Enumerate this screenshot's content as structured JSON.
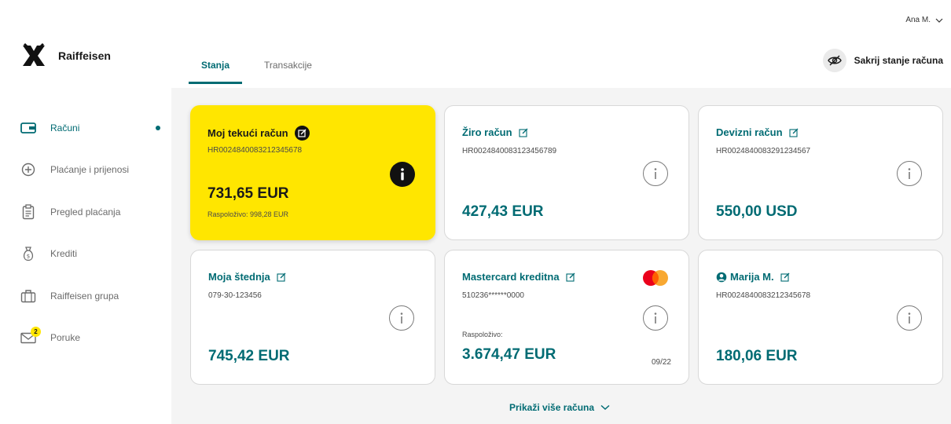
{
  "brand": {
    "name": "Raiffeisen",
    "accent": "#006b73",
    "highlight": "#ffe600"
  },
  "user": {
    "name": "Ana M."
  },
  "nav": [
    {
      "label": "Računi",
      "icon": "wallet-icon",
      "active": true
    },
    {
      "label": "Plaćanje i prijenosi",
      "icon": "plus-circle-icon"
    },
    {
      "label": "Pregled plaćanja",
      "icon": "clipboard-icon"
    },
    {
      "label": "Krediti",
      "icon": "money-bag-icon"
    },
    {
      "label": "Raiffeisen grupa",
      "icon": "briefcase-icon"
    },
    {
      "label": "Poruke",
      "icon": "envelope-icon",
      "badge": "2"
    }
  ],
  "tabs": [
    {
      "label": "Stanja",
      "active": true
    },
    {
      "label": "Transakcije"
    }
  ],
  "hide_balance": {
    "label": "Sakrij stanje računa",
    "icon": "eye-off-icon"
  },
  "accounts": [
    {
      "title": "Moj tekući račun",
      "iban": "HR0024840083212345678",
      "amount": "731,65 EUR",
      "available": "Raspoloživo: 998,28 EUR"
    },
    {
      "title": "Žiro račun",
      "iban": "HR0024840083123456789",
      "amount": "427,43 EUR"
    },
    {
      "title": "Devizni račun",
      "iban": "HR0024840083291234567",
      "amount": "550,00 USD"
    },
    {
      "title": "Moja štednja",
      "iban": "079-30-123456",
      "amount": "745,42 EUR"
    },
    {
      "title": "Mastercard kreditna",
      "iban": "510236******0000",
      "amount": "3.674,47 EUR",
      "available": "Raspoloživo:",
      "expiry": "09/22",
      "icon": "mastercard-icon"
    },
    {
      "title": "Marija M.",
      "iban": "HR0024840083212345678",
      "amount": "180,06 EUR",
      "icon": "user-circle-icon"
    }
  ],
  "show_more": {
    "label": "Prikaži više računa",
    "icon": "chevron-down-icon"
  }
}
